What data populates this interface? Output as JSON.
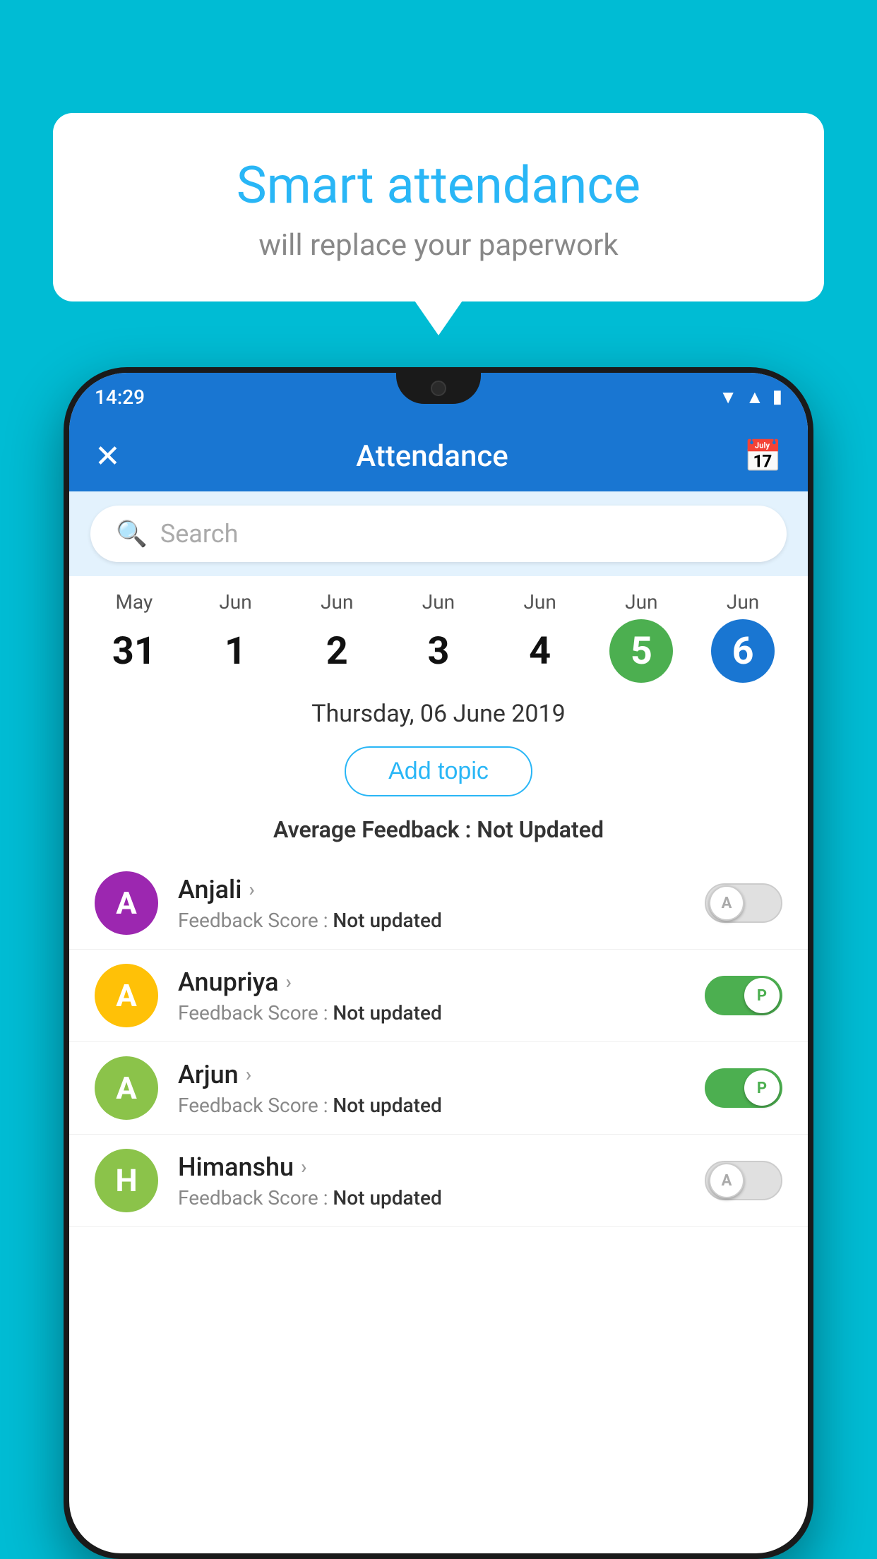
{
  "background_color": "#00bcd4",
  "speech_bubble": {
    "title": "Smart attendance",
    "subtitle": "will replace your paperwork"
  },
  "status_bar": {
    "time": "14:29",
    "signal_icon": "▼▲",
    "battery_icon": "▮"
  },
  "app_bar": {
    "title": "Attendance",
    "close_icon": "✕",
    "calendar_icon": "📅"
  },
  "search": {
    "placeholder": "Search"
  },
  "calendar": {
    "days": [
      {
        "month": "May",
        "date": "31",
        "style": "normal"
      },
      {
        "month": "Jun",
        "date": "1",
        "style": "normal"
      },
      {
        "month": "Jun",
        "date": "2",
        "style": "normal"
      },
      {
        "month": "Jun",
        "date": "3",
        "style": "normal"
      },
      {
        "month": "Jun",
        "date": "4",
        "style": "normal"
      },
      {
        "month": "Jun",
        "date": "5",
        "style": "green"
      },
      {
        "month": "Jun",
        "date": "6",
        "style": "blue"
      }
    ]
  },
  "selected_date": "Thursday, 06 June 2019",
  "add_topic_label": "Add topic",
  "avg_feedback_label": "Average Feedback :",
  "avg_feedback_value": "Not Updated",
  "students": [
    {
      "name": "Anjali",
      "avatar_letter": "A",
      "avatar_color": "#9c27b0",
      "feedback_label": "Feedback Score :",
      "feedback_value": "Not updated",
      "toggle": "off",
      "toggle_label": "A"
    },
    {
      "name": "Anupriya",
      "avatar_letter": "A",
      "avatar_color": "#ffc107",
      "feedback_label": "Feedback Score :",
      "feedback_value": "Not updated",
      "toggle": "on",
      "toggle_label": "P"
    },
    {
      "name": "Arjun",
      "avatar_letter": "A",
      "avatar_color": "#8bc34a",
      "feedback_label": "Feedback Score :",
      "feedback_value": "Not updated",
      "toggle": "on",
      "toggle_label": "P"
    },
    {
      "name": "Himanshu",
      "avatar_letter": "H",
      "avatar_color": "#8bc34a",
      "feedback_label": "Feedback Score :",
      "feedback_value": "Not updated",
      "toggle": "off",
      "toggle_label": "A"
    }
  ]
}
